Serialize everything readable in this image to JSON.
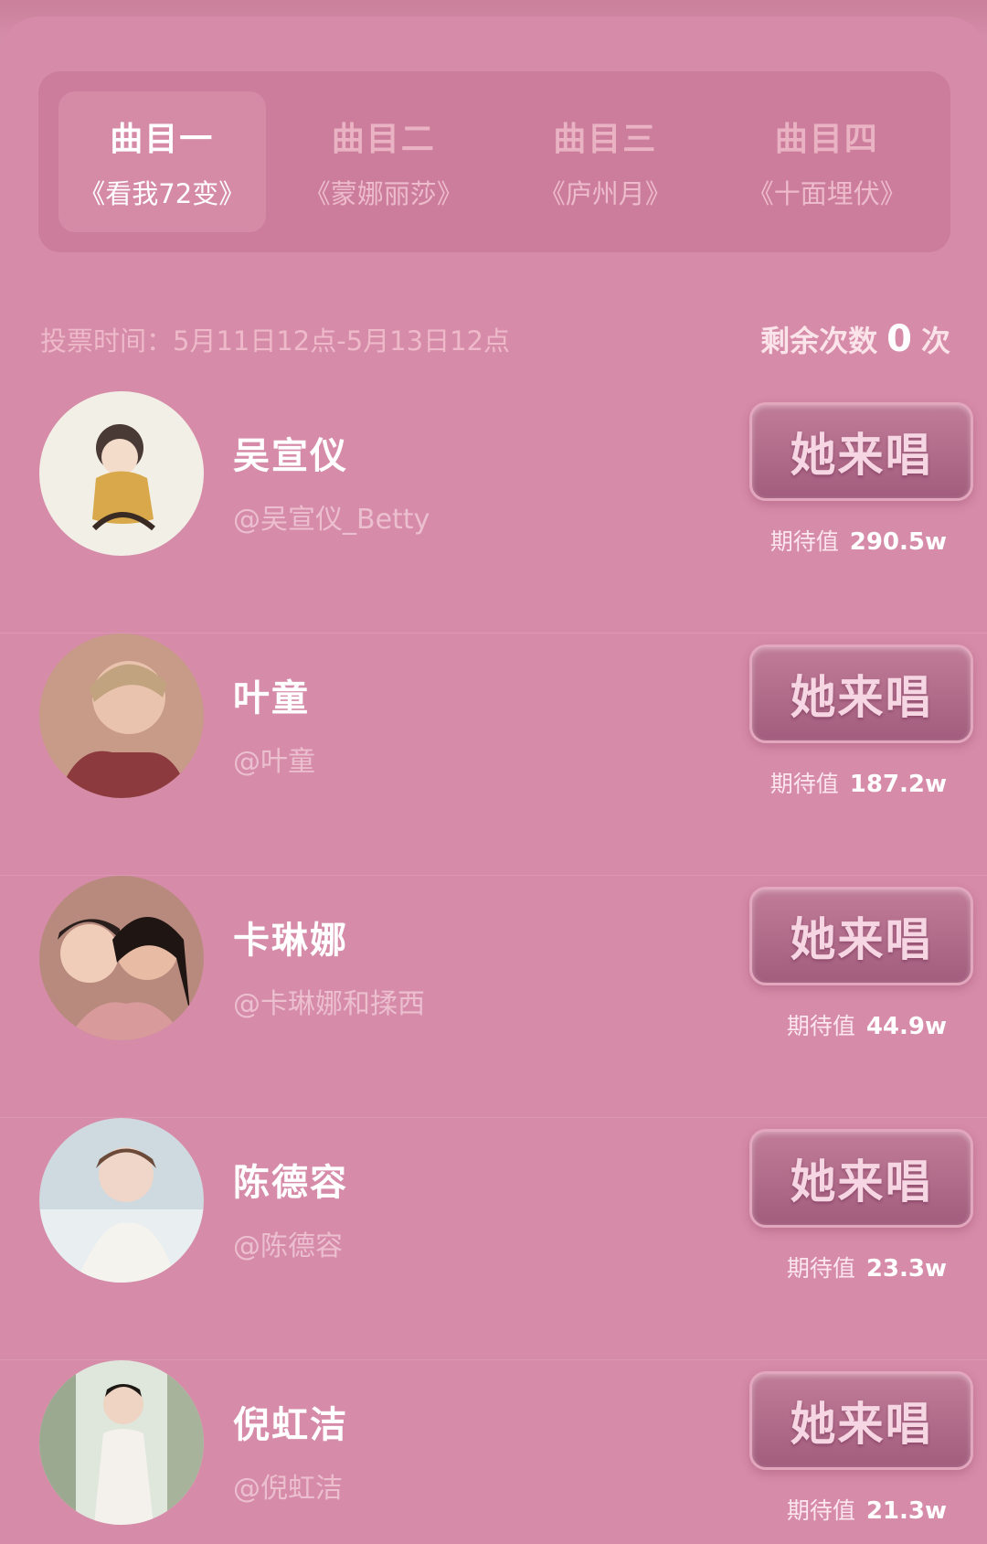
{
  "tabs": [
    {
      "title": "曲目一",
      "song": "《看我72变》",
      "active": true
    },
    {
      "title": "曲目二",
      "song": "《蒙娜丽莎》",
      "active": false
    },
    {
      "title": "曲目三",
      "song": "《庐州月》",
      "active": false
    },
    {
      "title": "曲目四",
      "song": "《十面埋伏》",
      "active": false
    }
  ],
  "vote_time": "投票时间：5月11日12点-5月13日12点",
  "remaining": {
    "label": "剩余次数",
    "count": "0",
    "unit": "次"
  },
  "sing_label": "她来唱",
  "expect_label": "期待值",
  "candidates": [
    {
      "name": "吴宣仪",
      "handle": "@吴宣仪_Betty",
      "expect": "290.5w"
    },
    {
      "name": "叶童",
      "handle": "@叶童",
      "expect": "187.2w"
    },
    {
      "name": "卡琳娜",
      "handle": "@卡琳娜和揉西",
      "expect": "44.9w"
    },
    {
      "name": "陈德容",
      "handle": "@陈德容",
      "expect": "23.3w"
    },
    {
      "name": "倪虹洁",
      "handle": "@倪虹洁",
      "expect": "21.3w"
    }
  ]
}
